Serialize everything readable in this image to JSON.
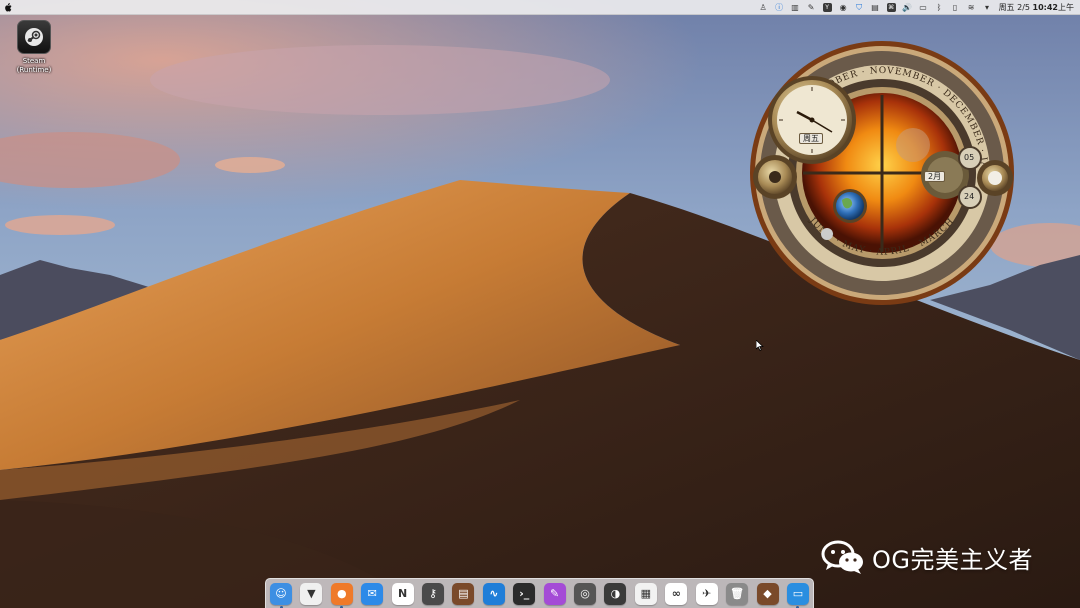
{
  "menubar": {
    "apple_icon": "apple-icon",
    "tray_icons": [
      "figure-icon",
      "info-icon",
      "book-icon",
      "pencil-icon",
      "y-badge-icon",
      "circle-icon",
      "shield-icon",
      "clipboard-icon",
      "keyboard-icon",
      "volume-icon",
      "battery-icon",
      "bluetooth-icon",
      "sidebar-icon",
      "wifi-icon",
      "dropdown-arrow-icon"
    ],
    "day": "周五",
    "date": "2/5",
    "time": "10:42",
    "ampm": "上午"
  },
  "desktop_icons": [
    {
      "name": "steam-icon",
      "label": "Steam (Runtime)"
    }
  ],
  "widget": {
    "day_label": "周五",
    "month_label": "2月",
    "date_top": "05",
    "date_bottom": "24",
    "months_arc": [
      "OCTOBER",
      "NOVEMBER",
      "DECEMBER",
      "JANUARY",
      "MAY",
      "APRIL",
      "MARCH",
      "JUNE"
    ]
  },
  "dock": {
    "items": [
      {
        "name": "finder",
        "color": "#3d8fe3",
        "glyph": "☺",
        "running": true
      },
      {
        "name": "brave",
        "color": "#f0f0f0",
        "glyph": "▼",
        "running": false
      },
      {
        "name": "firefox",
        "color": "#ef7a2a",
        "glyph": "●",
        "running": true
      },
      {
        "name": "mail",
        "color": "#2d8ae8",
        "glyph": "✉",
        "running": false
      },
      {
        "name": "notion",
        "color": "#ffffff",
        "glyph": "N",
        "running": false
      },
      {
        "name": "keychain",
        "color": "#4a4a4a",
        "glyph": "⚷",
        "running": false
      },
      {
        "name": "notebook",
        "color": "#7a4a2a",
        "glyph": "▤",
        "running": false
      },
      {
        "name": "activity-monitor",
        "color": "#1f7ed8",
        "glyph": "∿",
        "running": false
      },
      {
        "name": "terminal",
        "color": "#2b2b2b",
        "glyph": "›_",
        "running": false
      },
      {
        "name": "color-picker",
        "color": "#a44bd6",
        "glyph": "✎",
        "running": false
      },
      {
        "name": "disk-utility",
        "color": "#555555",
        "glyph": "◎",
        "running": false
      },
      {
        "name": "camera-app",
        "color": "#3a3a3a",
        "glyph": "◑",
        "running": false
      },
      {
        "name": "photo-booth",
        "color": "#f2f2f2",
        "glyph": "▦",
        "running": false
      },
      {
        "name": "baidu-netdisk",
        "color": "#ffffff",
        "glyph": "∞",
        "running": false
      },
      {
        "name": "feishu",
        "color": "#ffffff",
        "glyph": "✈",
        "running": false
      },
      {
        "name": "trash",
        "color": "#8a8a8a",
        "glyph": "🗑",
        "running": false
      },
      {
        "name": "stickies",
        "color": "#7a4a2a",
        "glyph": "◆",
        "running": false
      },
      {
        "name": "remote-desktop",
        "color": "#2a8ee0",
        "glyph": "▭",
        "running": true
      }
    ]
  },
  "watermark": {
    "text": "OG完美主义者"
  }
}
